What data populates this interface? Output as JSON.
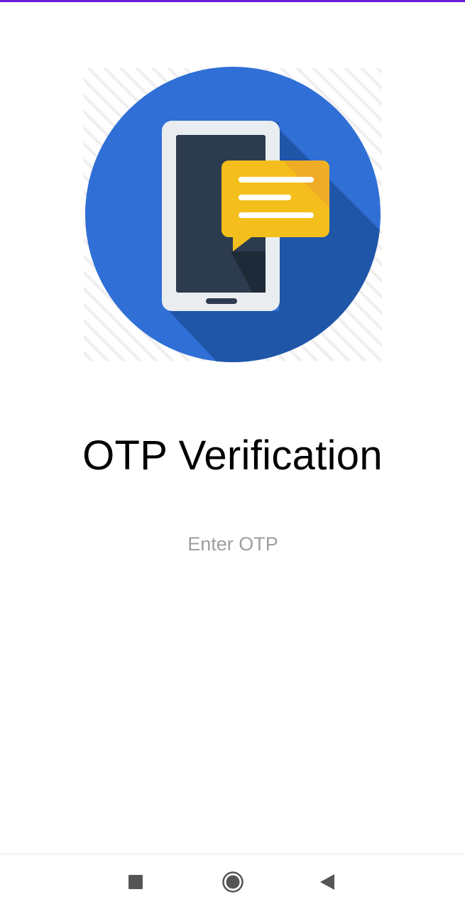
{
  "colors": {
    "top_accent": "#6a1bd8",
    "circle_blue": "#2f6fd6",
    "shadow_blue": "#1f56a8",
    "phone_frame": "#e9edf0",
    "phone_screen": "#2d3b4f",
    "bubble_yellow": "#f4bf1c",
    "bubble_orange": "#eea52a",
    "nav_icon": "#555555"
  },
  "icons": {
    "hero": "phone-message-illustration",
    "nav_recent": "square-icon",
    "nav_home": "circle-home-icon",
    "nav_back": "triangle-back-icon"
  },
  "screen": {
    "title": "OTP Verification",
    "otp_input": {
      "placeholder": "Enter OTP",
      "value": ""
    }
  }
}
